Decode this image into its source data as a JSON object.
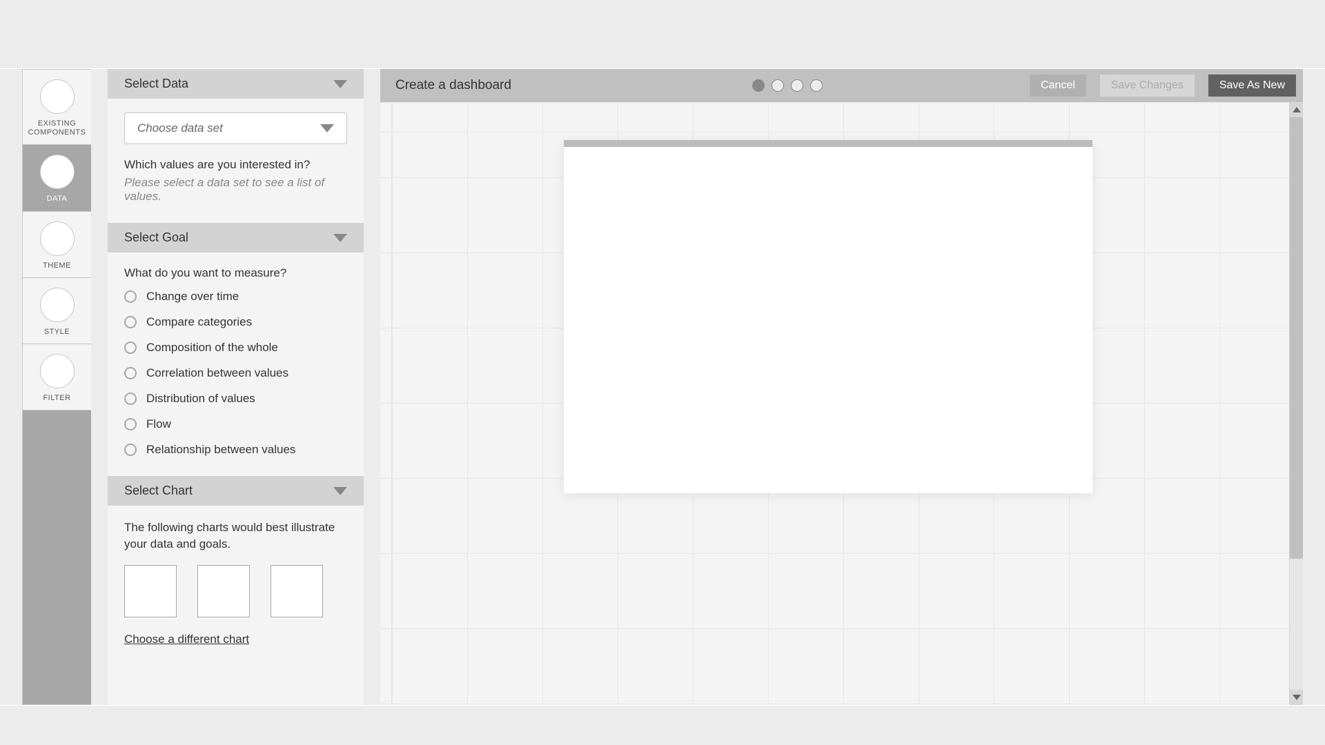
{
  "tabs": {
    "existing_components": "EXISTING COMPONENTS",
    "data": "DATA",
    "theme": "THEME",
    "style": "STYLE",
    "filter": "FILTER"
  },
  "sidebar": {
    "select_data": {
      "title": "Select Data",
      "dropdown_placeholder": "Choose data set",
      "question": "Which values are you interested in?",
      "hint": "Please select a data set to see a list of values."
    },
    "select_goal": {
      "title": "Select Goal",
      "question": "What do you want to measure?",
      "options": [
        "Change over time",
        "Compare categories",
        "Composition of the whole",
        "Correlation between values",
        "Distribution of values",
        "Flow",
        "Relationship between values"
      ]
    },
    "select_chart": {
      "title": "Select Chart",
      "desc": "The following charts would best illustrate your data and goals.",
      "link": "Choose a different chart"
    }
  },
  "header": {
    "title": "Create a dashboard",
    "cancel": "Cancel",
    "save_changes": "Save Changes",
    "save_as_new": "Save As New"
  },
  "steps": {
    "total": 4,
    "active": 0
  }
}
